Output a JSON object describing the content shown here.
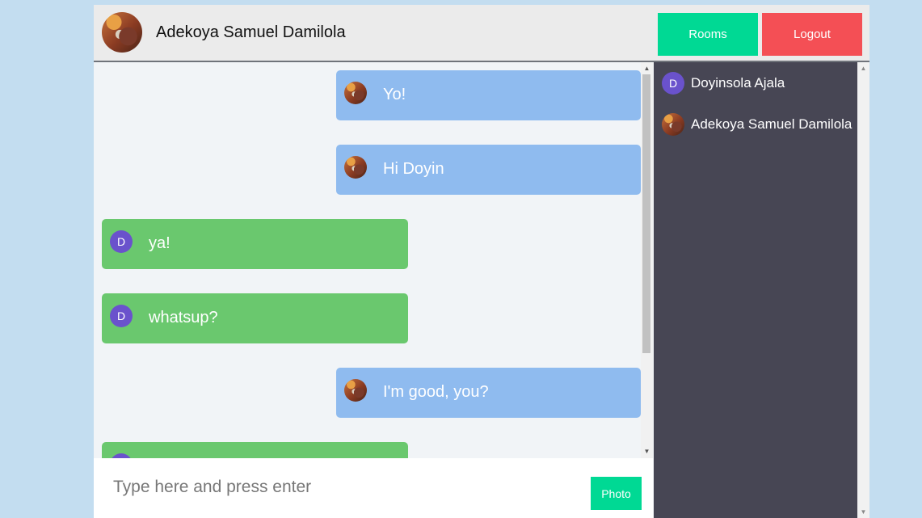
{
  "header": {
    "user_name": "Adekoya Samuel Damilola",
    "rooms_label": "Rooms",
    "logout_label": "Logout"
  },
  "messages": [
    {
      "text": "Yo!",
      "sender": "self"
    },
    {
      "text": "Hi Doyin",
      "sender": "self"
    },
    {
      "text": "ya!",
      "sender": "other",
      "initial": "D"
    },
    {
      "text": "whatsup?",
      "sender": "other",
      "initial": "D"
    },
    {
      "text": "I'm good, you?",
      "sender": "self"
    }
  ],
  "composer": {
    "placeholder": "Type here and press enter",
    "photo_label": "Photo"
  },
  "users": [
    {
      "name": "Doyinsola Ajala",
      "initial": "D"
    },
    {
      "name": "Adekoya Samuel Damilola"
    }
  ],
  "colors": {
    "accent_green": "#00d994",
    "logout_red": "#f44f55",
    "own_bubble": "#8fbbef",
    "other_bubble": "#6ac86e",
    "sidebar": "#474654",
    "initial_avatar": "#6a52cc"
  }
}
